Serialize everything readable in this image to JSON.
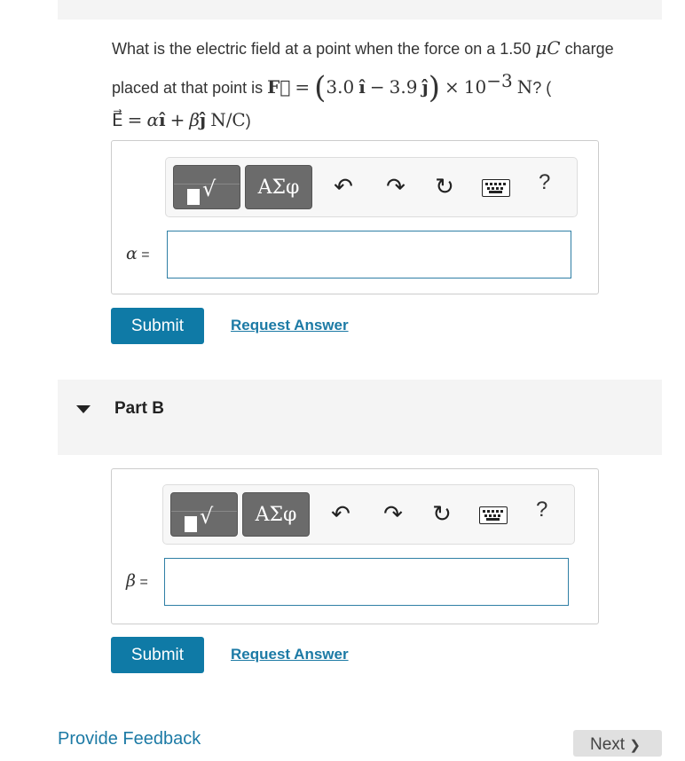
{
  "question": {
    "line1_text": "What is the electric field at a point when the force on a 1.50 ",
    "line1_unit": "μC",
    "line1_tail": " charge",
    "line2_text": "placed at that point is ",
    "force_symbol": "F⃗",
    "equals": "=",
    "open_paren": "(",
    "force_x": "3.0",
    "i_hat": "î",
    "minus": "−",
    "force_y": "3.9",
    "j_hat": "ĵ",
    "close_paren": ")",
    "times": "×",
    "ten": "10",
    "exponent": "−3",
    "force_unit": "N",
    "line2_tail": "? (",
    "e_symbol": "E⃗",
    "alpha": "α",
    "plus": "+",
    "beta": "β",
    "e_unit": "N/C",
    "close_note": ")"
  },
  "toolbar": {
    "templates_glyph": "√",
    "symbols_label": "ΑΣφ",
    "undo_glyph": "↶",
    "redo_glyph": "↷",
    "reset_glyph": "↻",
    "help_label": "?"
  },
  "part_a": {
    "var_symbol": "α",
    "var_eq": "=",
    "answer_value": "",
    "submit_label": "Submit",
    "request_label": "Request Answer"
  },
  "part_b": {
    "title": "Part B",
    "var_symbol": "β",
    "var_eq": "=",
    "answer_value": "",
    "submit_label": "Submit",
    "request_label": "Request Answer"
  },
  "footer": {
    "feedback_label": "Provide Feedback",
    "next_label": "Next",
    "next_glyph": "❯"
  },
  "colors": {
    "accent": "#0f7aa6",
    "link": "#1c7aa5",
    "band": "#f4f4f4"
  }
}
